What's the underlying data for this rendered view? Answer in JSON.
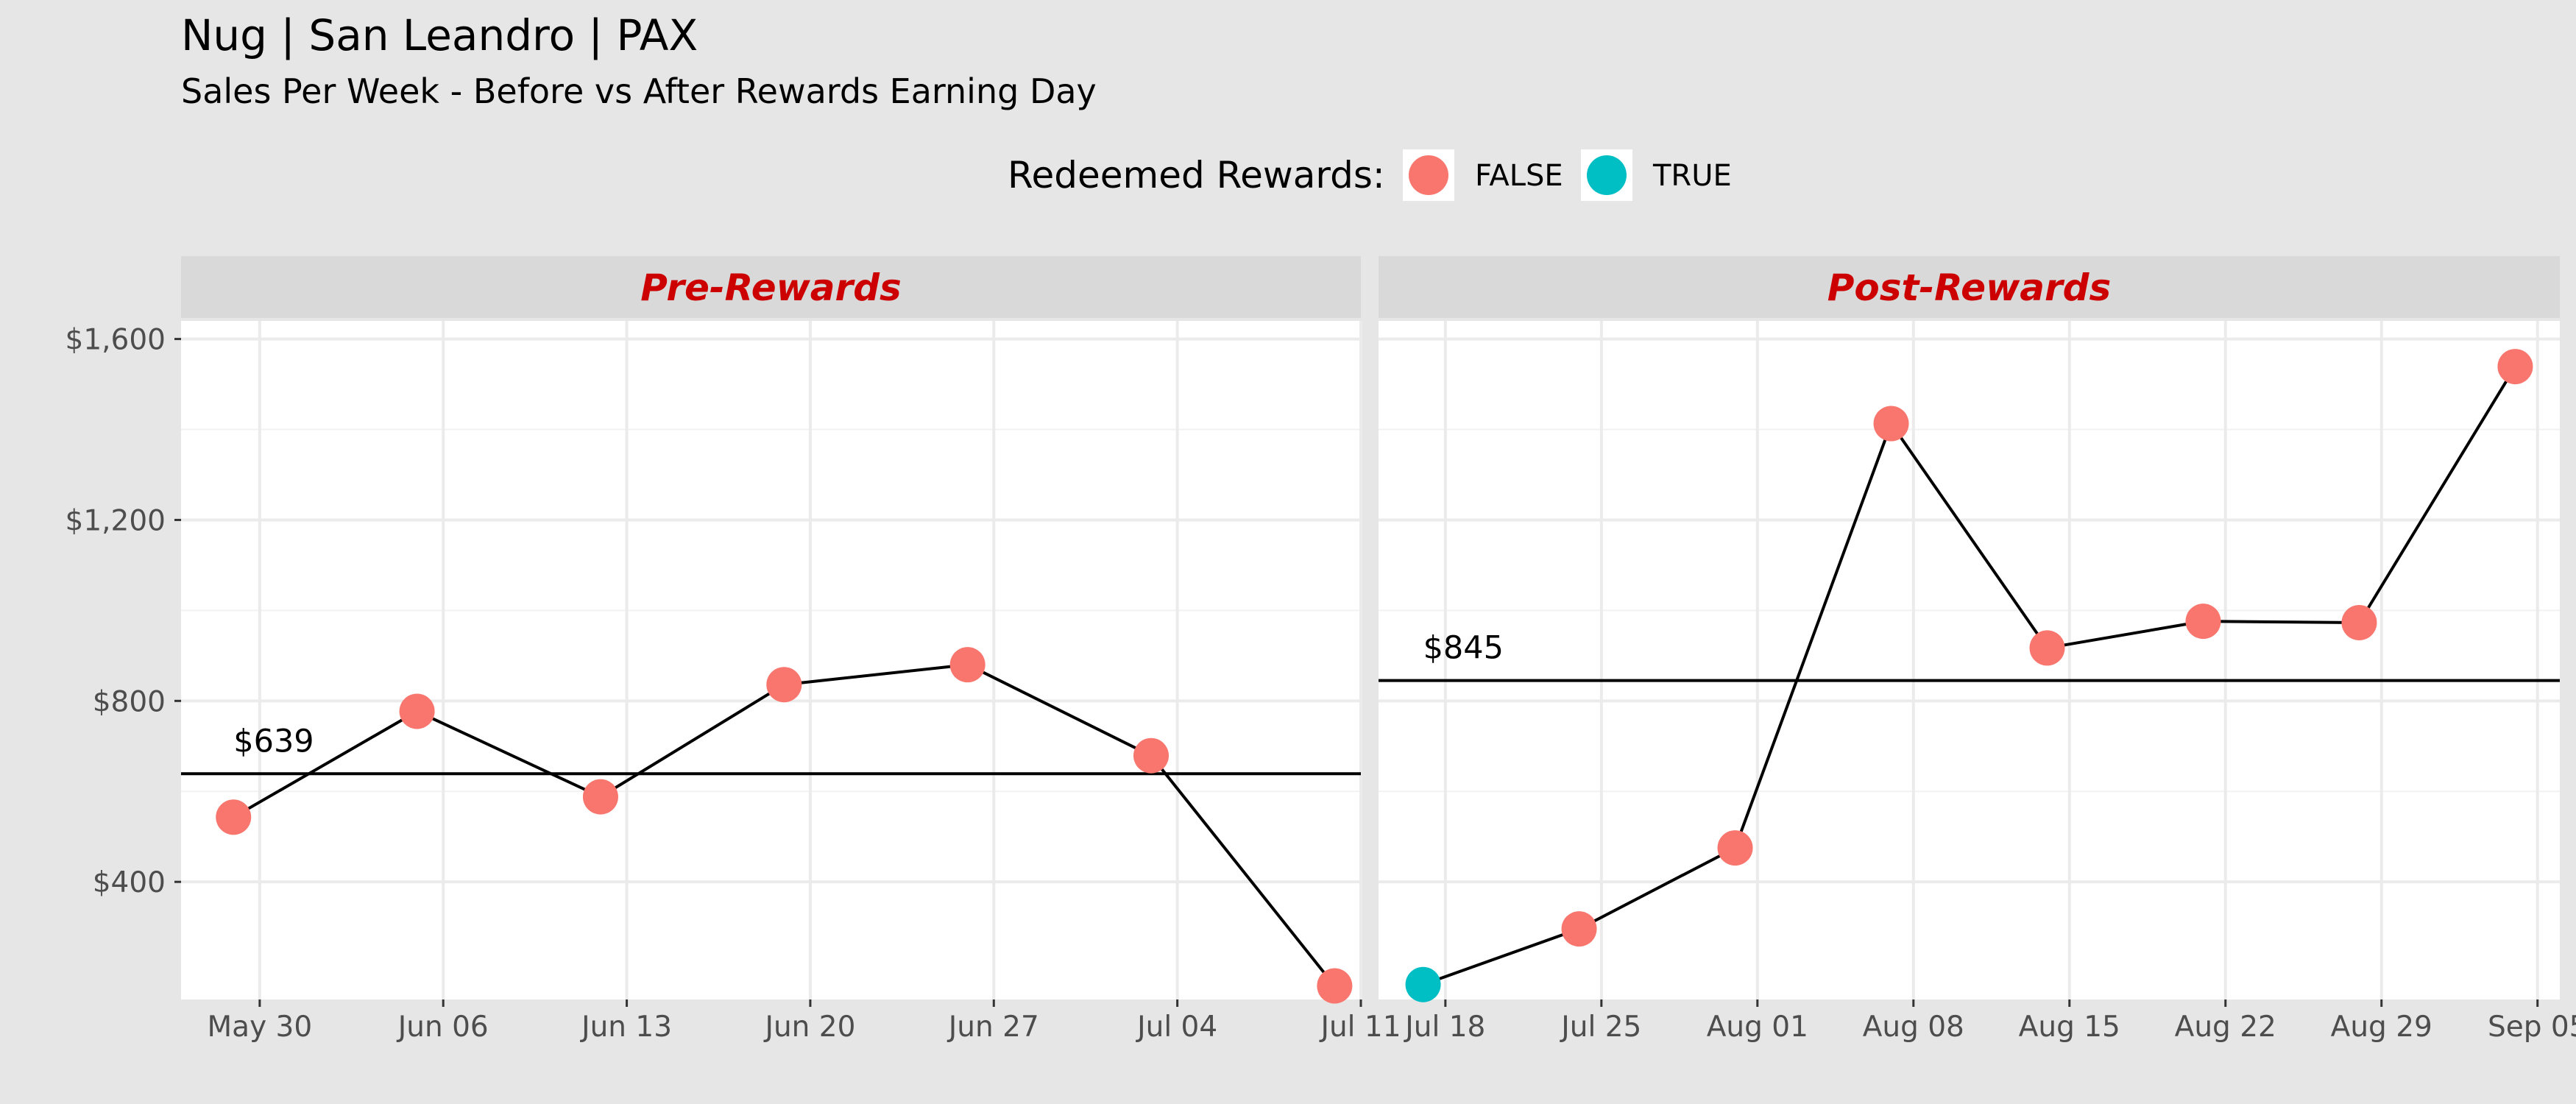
{
  "chart_data": {
    "type": "line",
    "title": "Nug | San Leandro | PAX",
    "subtitle": "Sales Per Week - Before vs After Rewards Earning Day",
    "legend": {
      "title": "Redeemed Rewards:",
      "position": "top",
      "entries": [
        {
          "label": "FALSE",
          "color": "#f8766d"
        },
        {
          "label": "TRUE",
          "color": "#00bfc4"
        }
      ]
    },
    "y_axis": {
      "ticks": [
        400,
        800,
        1200,
        1600
      ],
      "tick_labels": [
        "$400",
        "$800",
        "$1,200",
        "$1,600"
      ],
      "ylim": [
        140,
        1640
      ]
    },
    "grid": true,
    "panels": [
      {
        "label": "Pre-Rewards",
        "x_ticks": [
          "May 30",
          "Jun 06",
          "Jun 13",
          "Jun 20",
          "Jun 27",
          "Jul 04",
          "Jul 11"
        ],
        "x_tick_dates": [
          "2021-05-30",
          "2021-06-06",
          "2021-06-13",
          "2021-06-20",
          "2021-06-27",
          "2021-07-04",
          "2021-07-11"
        ],
        "xlim": [
          "2021-05-27",
          "2021-07-11"
        ],
        "average": 639,
        "average_label": "$639",
        "points": [
          {
            "date": "2021-05-29",
            "value": 543,
            "redeemed": "FALSE"
          },
          {
            "date": "2021-06-05",
            "value": 777,
            "redeemed": "FALSE"
          },
          {
            "date": "2021-06-12",
            "value": 588,
            "redeemed": "FALSE"
          },
          {
            "date": "2021-06-19",
            "value": 836,
            "redeemed": "FALSE"
          },
          {
            "date": "2021-06-26",
            "value": 880,
            "redeemed": "FALSE"
          },
          {
            "date": "2021-07-03",
            "value": 679,
            "redeemed": "FALSE"
          },
          {
            "date": "2021-07-10",
            "value": 170,
            "redeemed": "FALSE"
          }
        ]
      },
      {
        "label": "Post-Rewards",
        "x_ticks": [
          "Jul 18",
          "Jul 25",
          "Aug 01",
          "Aug 08",
          "Aug 15",
          "Aug 22",
          "Aug 29",
          "Sep 05"
        ],
        "x_tick_dates": [
          "2021-07-18",
          "2021-07-25",
          "2021-08-01",
          "2021-08-08",
          "2021-08-15",
          "2021-08-22",
          "2021-08-29",
          "2021-09-05"
        ],
        "xlim": [
          "2021-07-15",
          "2021-09-06"
        ],
        "average": 845,
        "average_label": "$845",
        "points": [
          {
            "date": "2021-07-17",
            "value": 173,
            "redeemed": "TRUE"
          },
          {
            "date": "2021-07-24",
            "value": 296,
            "redeemed": "FALSE"
          },
          {
            "date": "2021-07-31",
            "value": 475,
            "redeemed": "FALSE"
          },
          {
            "date": "2021-08-07",
            "value": 1413,
            "redeemed": "FALSE"
          },
          {
            "date": "2021-08-14",
            "value": 917,
            "redeemed": "FALSE"
          },
          {
            "date": "2021-08-21",
            "value": 976,
            "redeemed": "FALSE"
          },
          {
            "date": "2021-08-28",
            "value": 973,
            "redeemed": "FALSE"
          },
          {
            "date": "2021-09-04",
            "value": 1539,
            "redeemed": "FALSE"
          }
        ]
      }
    ]
  }
}
